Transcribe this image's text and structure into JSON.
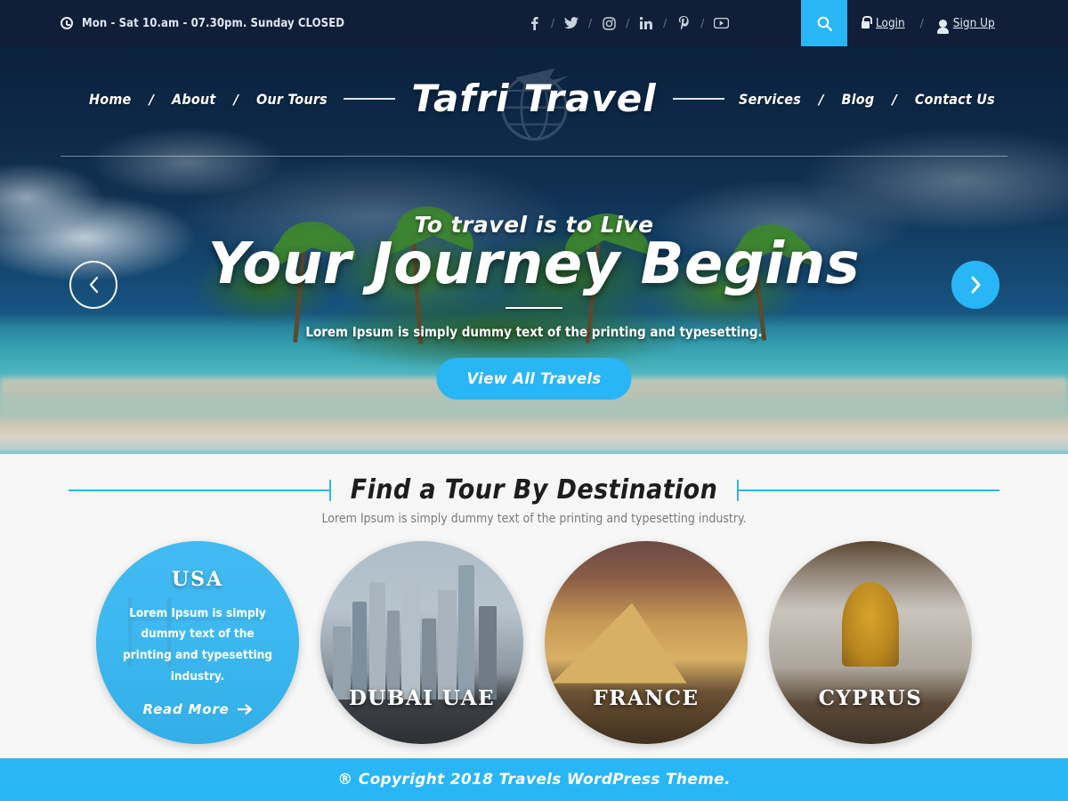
{
  "topbar": {
    "clock_icon": "clock-icon",
    "hours": "Mon - Sat 10.am - 07.30pm. Sunday CLOSED",
    "separator": "/",
    "socials": [
      {
        "name": "facebook",
        "glyph": "f"
      },
      {
        "name": "twitter",
        "glyph": "t"
      },
      {
        "name": "instagram",
        "glyph": "ig"
      },
      {
        "name": "linkedin",
        "glyph": "in"
      },
      {
        "name": "pinterest",
        "glyph": "P"
      },
      {
        "name": "youtube",
        "glyph": "yt"
      }
    ],
    "search_icon": "search-icon",
    "login_label": "Login",
    "signup_label": "Sign Up",
    "lock_icon": "lock-icon",
    "user_icon": "user-icon"
  },
  "nav": {
    "left": [
      "Home",
      "About",
      "Our Tours"
    ],
    "right": [
      "Services",
      "Blog",
      "Contact Us"
    ],
    "separator": "/",
    "logo": "Tafri Travel",
    "logo_watermark": "globe-airplane-icon"
  },
  "hero": {
    "subtitle": "To travel is to Live",
    "title": "Your Journey Begins",
    "description": "Lorem Ipsum is simply dummy text of the printing and typesetting.",
    "button": "View All Travels",
    "prev_icon": "chevron-left-icon",
    "next_icon": "chevron-right-icon"
  },
  "destinations": {
    "title": "Find a Tour By Destination",
    "description": "Lorem Ipsum is simply dummy text of the printing and typesetting industry.",
    "cards": [
      {
        "label": "USA",
        "active": true,
        "overlay_title": "USA",
        "overlay_text": "Lorem Ipsum is simply dummy text of the printing and typesetting industry.",
        "read_more": "Read More",
        "read_more_icon": "arrow-right-icon",
        "image": "golden-gate-bridge"
      },
      {
        "label": "DUBAI UAE",
        "active": false,
        "image": "dubai-skyscrapers"
      },
      {
        "label": "FRANCE",
        "active": false,
        "image": "louvre-pyramid"
      },
      {
        "label": "CYPRUS",
        "active": false,
        "image": "church-interior"
      }
    ]
  },
  "footer": {
    "copyright": "® Copyright 2018 Travels WordPress Theme."
  },
  "colors": {
    "accent": "#29b6f6",
    "topbar_bg": "#101e38",
    "section_bg": "#f7f7f7",
    "heading": "#1d1d1d"
  }
}
